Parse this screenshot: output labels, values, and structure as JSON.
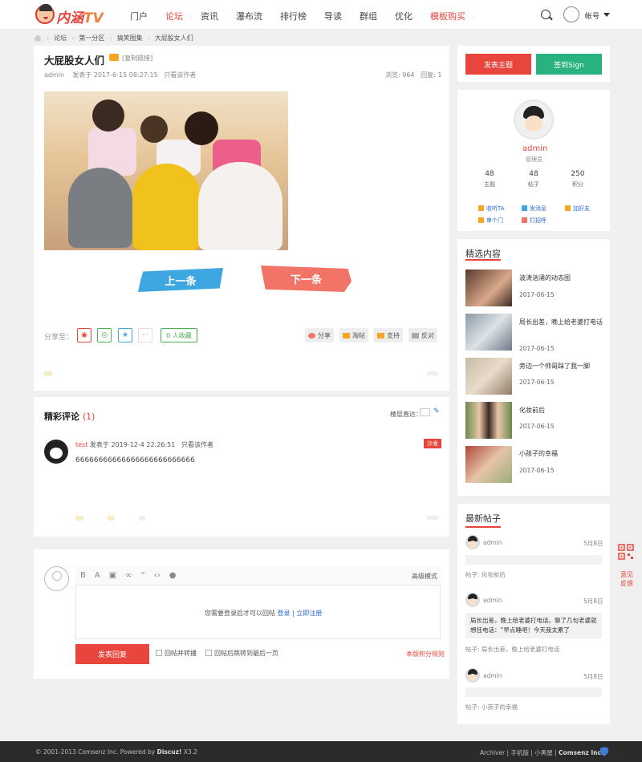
{
  "header": {
    "logo": {
      "text_a": "内涵",
      "text_b": "TV"
    },
    "nav": [
      "门户",
      "论坛",
      "资讯",
      "瀑布流",
      "排行榜",
      "导读",
      "群组",
      "优化",
      "模板购买"
    ],
    "account": "帐号"
  },
  "breadcrumb": [
    "论坛",
    "第一分区",
    "搞笑图集",
    "大屁股女人们"
  ],
  "thread": {
    "title": "大屁股女人们",
    "copy_link": "[复制链接]",
    "author": "admin",
    "posted": "发表于 2017-6-15 08:27:15",
    "only_author": "只看该作者",
    "views": "浏览: 964",
    "replies": "回复: 1",
    "prev_label": "上一条",
    "next_label": "下一条",
    "share_label": "分享至：",
    "fav_label": "0 人收藏",
    "actions": [
      "分享",
      "淘帖",
      "支持",
      "反对"
    ]
  },
  "comments": {
    "title": "精彩评论",
    "count": "(1)",
    "jump_label": "楼层直达：",
    "items": [
      {
        "user": "test",
        "posted": "发表于 2019-12-4 22:26:51",
        "only_author": "只看该作者",
        "badge": "沙发",
        "text": "66666666666666666666666666"
      }
    ]
  },
  "reply": {
    "toolbar": [
      "B",
      "A",
      "▣",
      "∞",
      "“",
      "‹›",
      "●"
    ],
    "advanced": "高级模式",
    "login_prefix": "您需要登录后才可以回帖",
    "login_link": "登录",
    "sep": "|",
    "register_link": "立即注册",
    "submit": "发表回复",
    "opt1": "回帖并转播",
    "opt2": "回帖后跳转到最后一页",
    "rules": "本版积分规则"
  },
  "sidebar": {
    "post_btn": "发表主题",
    "sign_btn": "签到Sign",
    "profile": {
      "name": "admin",
      "role": "管理员",
      "stats": [
        {
          "n": "48",
          "l": "主题"
        },
        {
          "n": "48",
          "l": "帖子"
        },
        {
          "n": "250",
          "l": "积分"
        }
      ],
      "links": [
        "收听TA",
        "发消息",
        "加好友",
        "串个门",
        "打招呼"
      ]
    },
    "featured": {
      "title": "精选内容",
      "items": [
        {
          "title": "波涛汹涌的动态图",
          "date": "2017-06-15"
        },
        {
          "title": "局长出差，晚上给老婆打电话",
          "date": "2017-06-15"
        },
        {
          "title": "旁边一个帅哥踩了我一脚",
          "date": "2017-06-15"
        },
        {
          "title": "化妆前后",
          "date": "2017-06-15"
        },
        {
          "title": "小孩子的幸福",
          "date": "2017-06-15"
        }
      ]
    },
    "latest": {
      "title": "最新帖子",
      "items": [
        {
          "user": "admin",
          "date": "5月8日",
          "text": "",
          "post": "帖子: 化妆前后"
        },
        {
          "user": "admin",
          "date": "5月8日",
          "text": "局长出差，晚上给老婆打电话。聊了几句老婆就想挂电话：“早点睡吧！今天我太累了",
          "post": "帖子: 局长出差，晚上给老婆打电话"
        },
        {
          "user": "admin",
          "date": "5月8日",
          "text": "",
          "post": "帖子: 小孩子的幸福"
        }
      ]
    },
    "feedback": "意见反馈"
  },
  "footer": {
    "left_prefix": "© 2001-2013 Comsenz Inc.  Powered by",
    "left_brand": "Discuz!",
    "left_ver": "X3.2",
    "right_links": "Archiver | 手机版 | 小黑屋 |",
    "right_brand": "Comsenz Inc."
  }
}
